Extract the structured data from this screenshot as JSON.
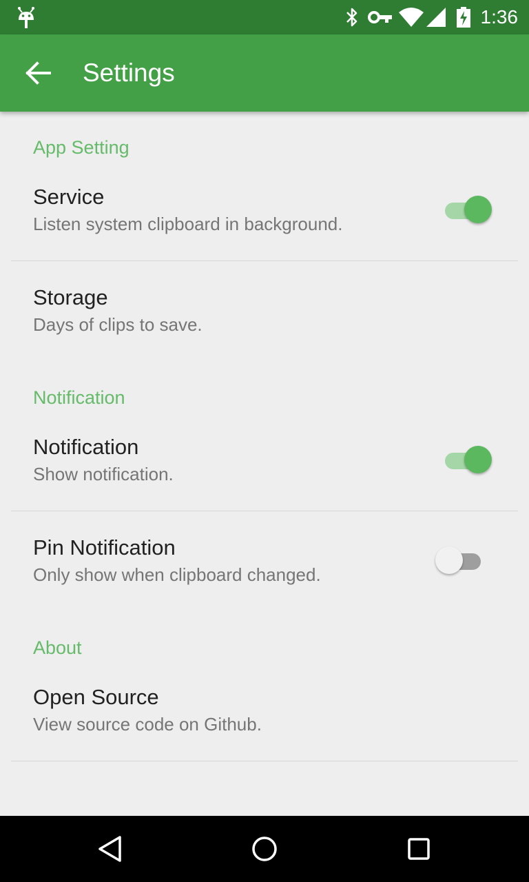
{
  "status_bar": {
    "time": "1:36",
    "icons": [
      "android-icon",
      "bluetooth-icon",
      "vpn-key-icon",
      "wifi-icon",
      "cell-signal-icon",
      "battery-charging-icon"
    ]
  },
  "app_bar": {
    "title": "Settings",
    "back_icon": "arrow-back-icon"
  },
  "categories": {
    "app_setting": {
      "title": "App Setting",
      "service": {
        "title": "Service",
        "summary": "Listen system clipboard in background.",
        "enabled": true
      },
      "storage": {
        "title": "Storage",
        "summary": "Days of clips to save."
      }
    },
    "notification": {
      "title": "Notification",
      "notification": {
        "title": "Notification",
        "summary": "Show notification.",
        "enabled": true
      },
      "pin_notification": {
        "title": "Pin Notification",
        "summary": "Only show when clipboard changed.",
        "enabled": false
      }
    },
    "about": {
      "title": "About",
      "open_source": {
        "title": "Open Source",
        "summary": "View source code on Github."
      }
    }
  },
  "colors": {
    "status_bar": "#2e7d32",
    "app_bar": "#43a047",
    "accent": "#66bb6a",
    "switch_on": "#5cb85f",
    "background": "#eeeeee"
  },
  "nav_bar": {
    "icons": [
      "back-triangle-icon",
      "home-circle-icon",
      "recents-square-icon"
    ]
  }
}
